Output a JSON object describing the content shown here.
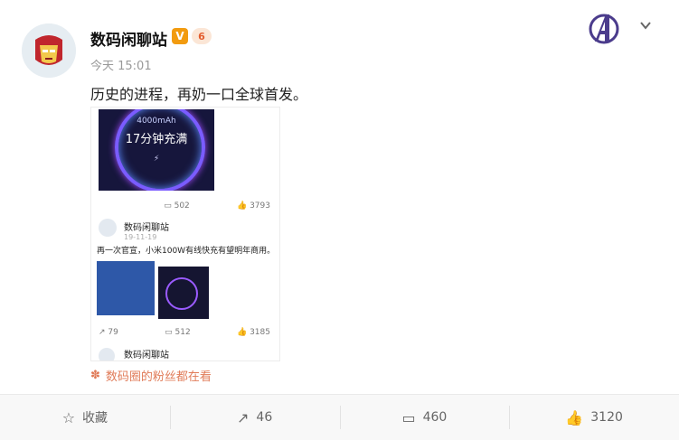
{
  "user": {
    "name": "数码闲聊站",
    "badge_v": "V",
    "badge_level": "6",
    "timestamp": "今天 15:01"
  },
  "post": {
    "text": "历史的进程，再奶一口全球首发。"
  },
  "embedded": {
    "image1": {
      "top_text": "4000mAh",
      "headline": "17分钟充满"
    },
    "stats1": {
      "comments": "502",
      "likes": "3793"
    },
    "repost": {
      "user": "数码闲聊站",
      "time": "19-11-19",
      "text": "再一次官宣，小米100W有线快充有望明年商用。"
    },
    "stats2": {
      "reposts": "79",
      "comments": "512",
      "likes": "3185"
    },
    "footer_user": "数码闲聊站"
  },
  "fans_note": "数码圈的粉丝都在看",
  "actions": {
    "favorite": "收藏",
    "repost": "46",
    "comment": "460",
    "like": "3120"
  },
  "icons": {
    "chevron": "chevron-down-icon",
    "avengers": "avengers-logo-icon",
    "favorite": "star-icon",
    "repost": "share-icon",
    "comment": "comment-icon",
    "like": "thumbs-up-icon"
  }
}
